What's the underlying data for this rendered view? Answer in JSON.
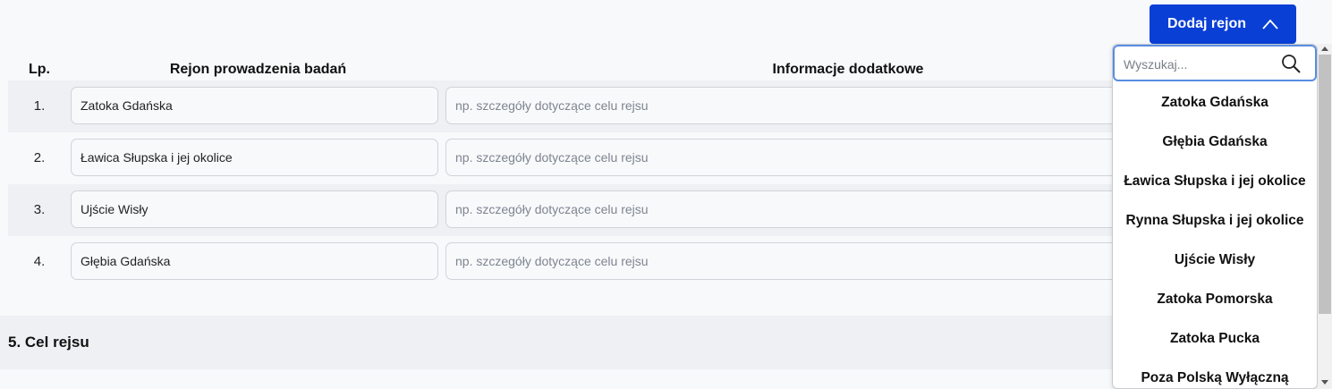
{
  "add_button": {
    "label": "Dodaj rejon"
  },
  "table": {
    "headers": {
      "lp": "Lp.",
      "region": "Rejon prowadzenia badań",
      "info": "Informacje dodatkowe"
    },
    "info_placeholder": "np. szczegóły dotyczące celu rejsu",
    "rows": [
      {
        "lp": "1.",
        "region": "Zatoka Gdańska"
      },
      {
        "lp": "2.",
        "region": "Ławica Słupska i jej okolice"
      },
      {
        "lp": "3.",
        "region": "Ujście Wisły"
      },
      {
        "lp": "4.",
        "region": "Głębia Gdańska"
      }
    ]
  },
  "next_section": {
    "title": "5. Cel rejsu"
  },
  "dropdown": {
    "search_placeholder": "Wyszukaj...",
    "options": [
      "Zatoka Gdańska",
      "Głębia Gdańska",
      "Ławica Słupska i jej okolice",
      "Rynna Słupska i jej okolice",
      "Ujście Wisły",
      "Zatoka Pomorska",
      "Zatoka Pucka",
      "Poza Polską Wyłączną"
    ]
  },
  "colors": {
    "accent": "#0a3fd6",
    "search_border": "#5a8de0",
    "row_shade": "#eef0f3"
  }
}
